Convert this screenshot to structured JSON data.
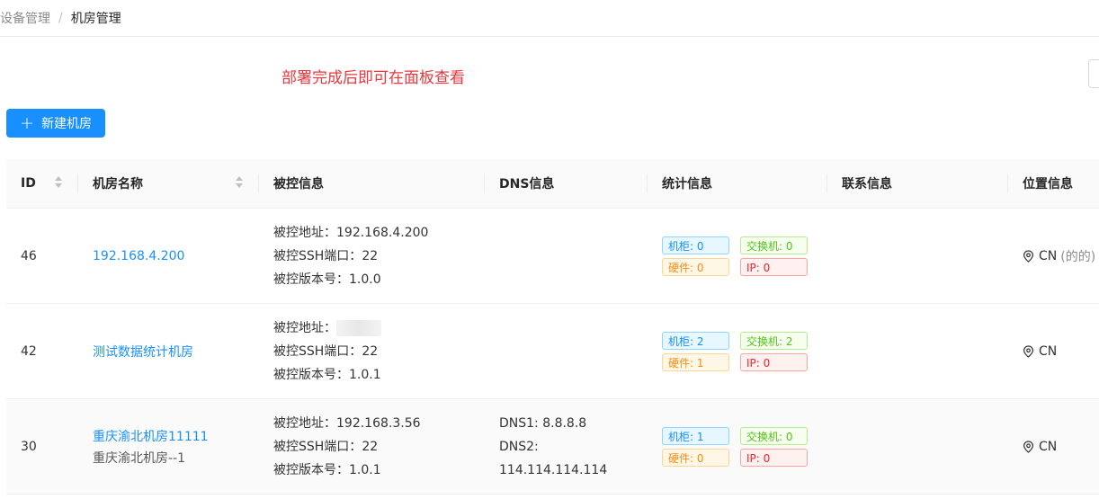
{
  "breadcrumb": {
    "parent": "设备管理",
    "separator": "/",
    "current": "机房管理"
  },
  "notice": "部署完成后即可在面板查看",
  "new_button": {
    "label": "新建机房",
    "icon": "plus-icon"
  },
  "columns": {
    "id": "ID",
    "name": "机房名称",
    "controlled": "被控信息",
    "dns": "DNS信息",
    "stats": "统计信息",
    "contact": "联系信息",
    "location": "位置信息"
  },
  "labels": {
    "address": "被控地址：",
    "ssh_port": "被控SSH端口：",
    "version": "被控版本号：",
    "dns1": "DNS1: ",
    "dns2": "DNS2: "
  },
  "rows": [
    {
      "id": "46",
      "name": "192.168.4.200",
      "subname": "",
      "address": "192.168.4.200",
      "ssh_port": "22",
      "version": "1.0.0",
      "dns1": "",
      "dns2": "",
      "stats": {
        "cabinet": "机柜: 0",
        "switch": "交换机: 0",
        "hardware": "硬件: 0",
        "ip": "IP: 0"
      },
      "location": "CN",
      "location_extra": "(的的)"
    },
    {
      "id": "42",
      "name": "测试数据统计机房",
      "subname": "",
      "address": "",
      "ssh_port": "22",
      "version": "1.0.1",
      "dns1": "",
      "dns2": "",
      "stats": {
        "cabinet": "机柜: 2",
        "switch": "交换机: 2",
        "hardware": "硬件: 1",
        "ip": "IP: 0"
      },
      "location": "CN",
      "location_extra": ""
    },
    {
      "id": "30",
      "name": "重庆渝北机房11111",
      "subname": "重庆渝北机房--1",
      "address": "192.168.3.56",
      "ssh_port": "22",
      "version": "1.0.1",
      "dns1": "8.8.8.8",
      "dns2": "114.114.114.114",
      "stats": {
        "cabinet": "机柜: 1",
        "switch": "交换机: 0",
        "hardware": "硬件: 0",
        "ip": "IP: 0"
      },
      "location": "CN",
      "location_extra": ""
    }
  ],
  "colors": {
    "primary": "#1890ff",
    "notice": "#e8373d"
  }
}
